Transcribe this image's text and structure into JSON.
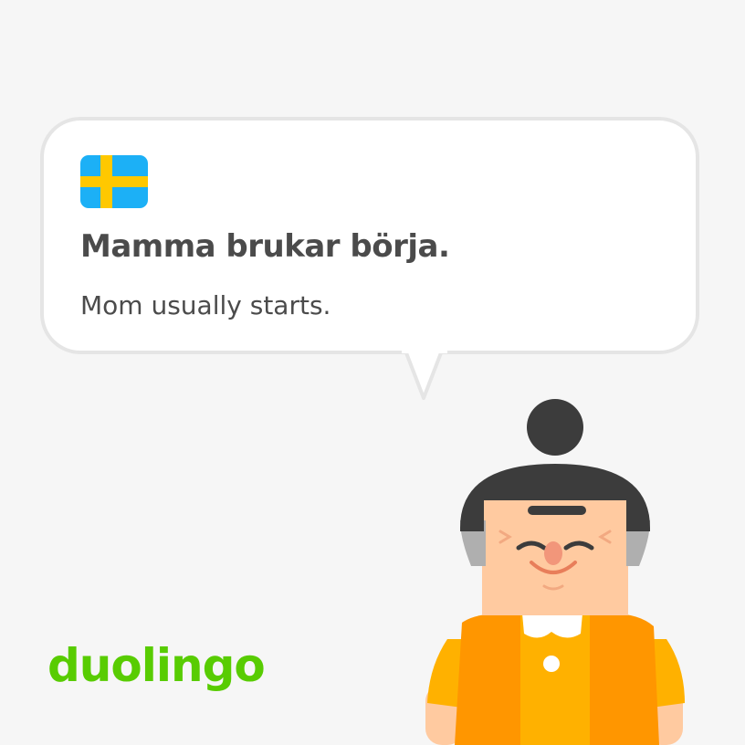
{
  "card": {
    "flag_icon": "sweden-flag-icon",
    "sentence": "Mamma brukar börja.",
    "translation": "Mom usually starts."
  },
  "brand": {
    "logo_text": "duolingo",
    "logo_color": "#58cc02"
  },
  "character": {
    "icon": "grandmother-character-icon"
  },
  "colors": {
    "background": "#f6f6f6",
    "bubble": "#ffffff",
    "bubble_border": "#e5e5e5",
    "text": "#4b4b4b",
    "flag_blue": "#1cb0f6",
    "flag_yellow": "#ffc800"
  }
}
